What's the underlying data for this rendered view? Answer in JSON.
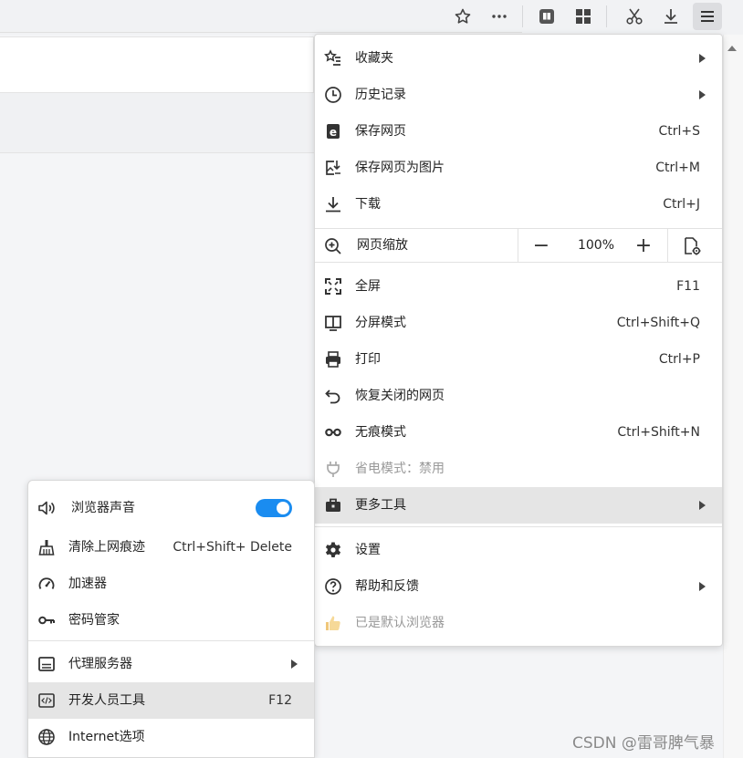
{
  "toolbar": {
    "icons": [
      "star-icon",
      "more-icon",
      "reader-icon",
      "apps-icon",
      "scissors-icon",
      "download-icon",
      "menu-icon"
    ]
  },
  "menu": {
    "items": [
      {
        "label": "收藏夹",
        "icon": "favorites-icon",
        "submenu": true
      },
      {
        "label": "历史记录",
        "icon": "history-icon",
        "submenu": true
      },
      {
        "label": "保存网页",
        "icon": "save-page-icon",
        "shortcut": "Ctrl+S"
      },
      {
        "label": "保存网页为图片",
        "icon": "save-image-icon",
        "shortcut": "Ctrl+M"
      },
      {
        "label": "下载",
        "icon": "download-icon",
        "shortcut": "Ctrl+J"
      }
    ],
    "zoom": {
      "label": "网页缩放",
      "minus": "−",
      "value": "100%",
      "plus": "+"
    },
    "items2": [
      {
        "label": "全屏",
        "icon": "fullscreen-icon",
        "shortcut": "F11"
      },
      {
        "label": "分屏模式",
        "icon": "split-screen-icon",
        "shortcut": "Ctrl+Shift+Q"
      },
      {
        "label": "打印",
        "icon": "print-icon",
        "shortcut": "Ctrl+P"
      },
      {
        "label": "恢复关闭的网页",
        "icon": "restore-icon"
      },
      {
        "label": "无痕模式",
        "icon": "incognito-icon",
        "shortcut": "Ctrl+Shift+N"
      },
      {
        "label": "省电模式：禁用",
        "icon": "power-saver-icon",
        "disabled": true
      },
      {
        "label": "更多工具",
        "icon": "toolbox-icon",
        "submenu": true,
        "highlighted": true
      }
    ],
    "items3": [
      {
        "label": "设置",
        "icon": "settings-icon"
      },
      {
        "label": "帮助和反馈",
        "icon": "help-icon",
        "submenu": true
      },
      {
        "label": "已是默认浏览器",
        "icon": "thumbs-up-icon",
        "disabled": true
      }
    ]
  },
  "submenu": {
    "items": [
      {
        "label": "浏览器声音",
        "icon": "speaker-icon",
        "toggle": true
      },
      {
        "label": "清除上网痕迹",
        "icon": "broom-icon",
        "shortcut": "Ctrl+Shift+ Delete"
      },
      {
        "label": "加速器",
        "icon": "speedometer-icon"
      },
      {
        "label": "密码管家",
        "icon": "key-icon"
      },
      {
        "label": "代理服务器",
        "icon": "proxy-icon",
        "submenu": true
      },
      {
        "label": "开发人员工具",
        "icon": "devtools-icon",
        "shortcut": "F12",
        "highlighted": true
      },
      {
        "label": "Internet选项",
        "icon": "globe-icon"
      }
    ]
  },
  "watermark": "CSDN @雷哥脾气暴",
  "colors": {
    "accent": "#1a8cf0",
    "highlight": "#e5e5e5"
  }
}
